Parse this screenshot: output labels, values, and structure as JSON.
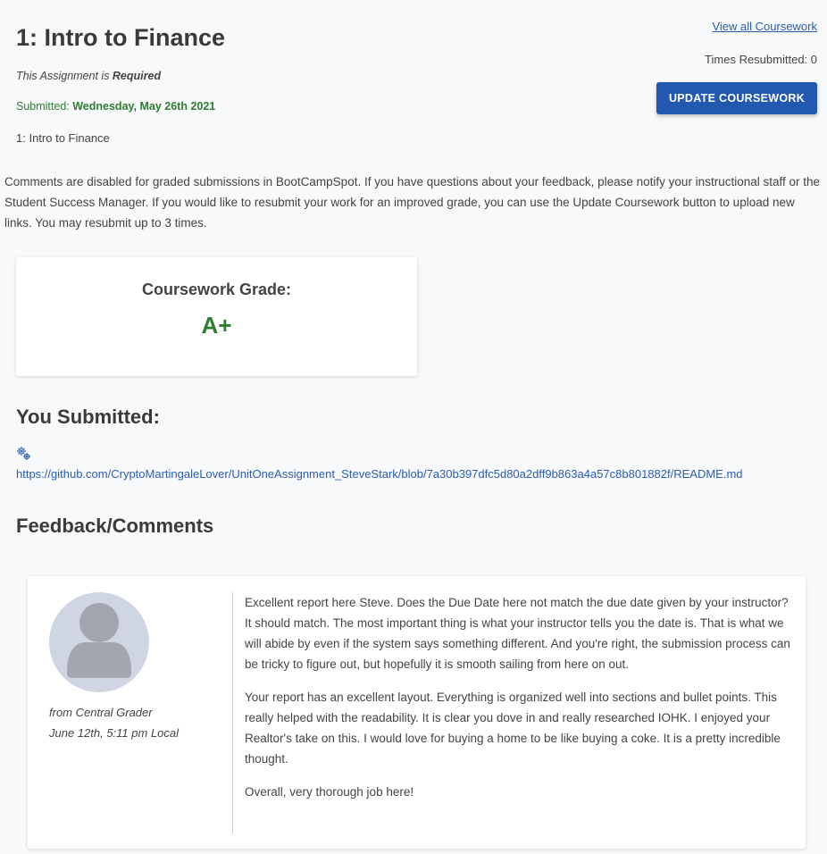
{
  "assignment": {
    "title": "1: Intro to Finance",
    "required_prefix": "This Assignment is ",
    "required_value": "Required",
    "submitted_label": "Submitted: ",
    "submitted_date": "Wednesday, May 26th 2021",
    "subtitle": "1: Intro to Finance"
  },
  "actions": {
    "view_all": "View all Coursework",
    "times_resubmitted": "Times Resubmitted: 0",
    "update_button": "UPDATE COURSEWORK"
  },
  "notice": "Comments are disabled for graded submissions in BootCampSpot. If you have questions about your feedback, please notify your instructional staff or the Student Success Manager. If you would like to resubmit your work for an improved grade, you can use the Update Coursework button to upload new links. You may resubmit up to 3 times.",
  "grade": {
    "label": "Coursework Grade:",
    "value": "A+"
  },
  "submission": {
    "heading": "You Submitted:",
    "icon": "link-gears-icon",
    "link": "https://github.com/CryptoMartingaleLover/UnitOneAssignment_SteveStark/blob/7a30b397dfc5d80a2dff9b863a4a57c8b801882f/README.md"
  },
  "feedback": {
    "heading": "Feedback/Comments",
    "grader": "from Central Grader",
    "timestamp": "June 12th, 5:11 pm Local",
    "paragraphs": [
      "Excellent report here Steve. Does the Due Date here not match the due date given by your instructor? It should match. The most important thing is what your instructor tells you the date is. That is what we will abide by even if the system says something different. And you're right, the submission process can be tricky to figure out, but hopefully it is smooth sailing from here on out.",
      "Your report has an excellent layout. Everything is organized well into sections and bullet points. This really helped with the readability. It is clear you dove in and really researched IOHK. I enjoyed your Realtor's take on this. I would love for buying a home to be like buying a coke. It is a pretty incredible thought.",
      "Overall, very thorough job here!"
    ]
  },
  "colors": {
    "accent": "#2258b0",
    "success": "#2e7d32",
    "link": "#2a5db0",
    "background": "#f8f9fb"
  }
}
